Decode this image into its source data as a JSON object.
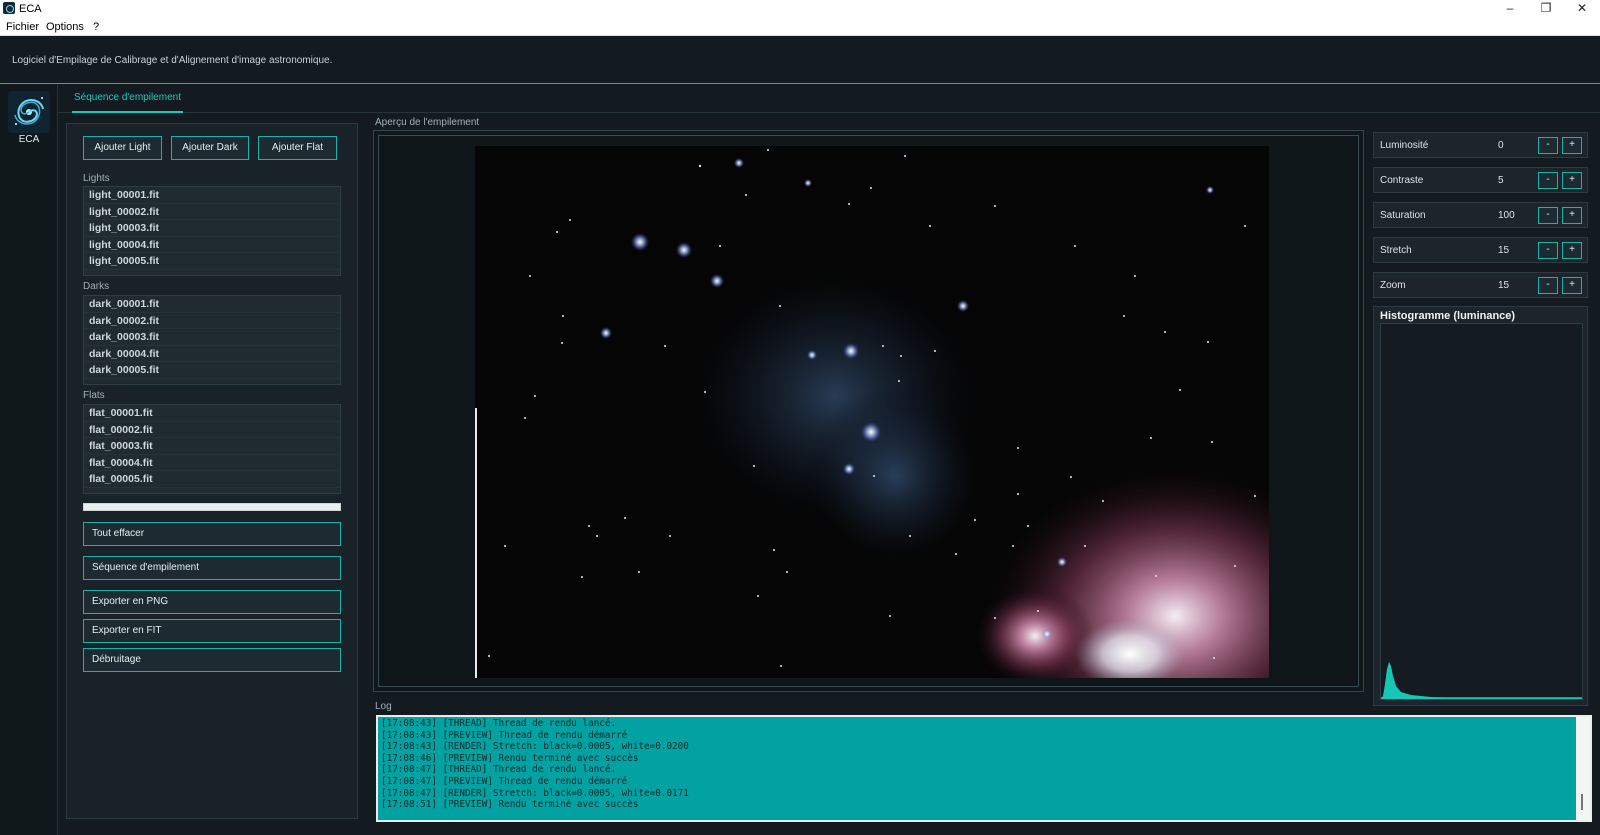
{
  "window": {
    "title": "ECA",
    "minimize": "–",
    "restore": "❐",
    "close": "✕"
  },
  "menu": {
    "items": [
      "Fichier",
      "Options",
      "?"
    ]
  },
  "header": {
    "subtitle": "Logiciel d'Empilage de Calibrage et d'Alignement d'image astronomique."
  },
  "rail": {
    "logo_label": "ECA",
    "logo_icon": "galaxy-icon"
  },
  "tabs": [
    {
      "label": "Séquence d'empilement"
    }
  ],
  "left": {
    "add_light": "Ajouter Light",
    "add_dark": "Ajouter Dark",
    "add_flat": "Ajouter Flat",
    "lights_label": "Lights",
    "lights": [
      "light_00001.fit",
      "light_00002.fit",
      "light_00003.fit",
      "light_00004.fit",
      "light_00005.fit"
    ],
    "darks_label": "Darks",
    "darks": [
      "dark_00001.fit",
      "dark_00002.fit",
      "dark_00003.fit",
      "dark_00004.fit",
      "dark_00005.fit"
    ],
    "flats_label": "Flats",
    "flats": [
      "flat_00001.fit",
      "flat_00002.fit",
      "flat_00003.fit",
      "flat_00004.fit",
      "flat_00005.fit"
    ],
    "progress": 0,
    "clear_all": "Tout effacer",
    "stack_sequence": "Séquence d'empilement",
    "export_png": "Exporter en PNG",
    "export_fit": "Exporter en FIT",
    "denoise": "Débruitage"
  },
  "preview": {
    "label": "Aperçu de l'empilement"
  },
  "controls": [
    {
      "label": "Luminosité",
      "value": "0",
      "minus": "-",
      "plus": "+"
    },
    {
      "label": "Contraste",
      "value": "5",
      "minus": "-",
      "plus": "+"
    },
    {
      "label": "Saturation",
      "value": "100",
      "minus": "-",
      "plus": "+"
    },
    {
      "label": "Stretch",
      "value": "15",
      "minus": "-",
      "plus": "+"
    },
    {
      "label": "Zoom",
      "value": "15",
      "minus": "-",
      "plus": "+"
    }
  ],
  "histogram": {
    "title": "Histogramme (luminance)",
    "color": "#1fc9bc"
  },
  "log": {
    "label": "Log",
    "lines": [
      "[17:08:43] [THREAD] Thread de rendu lancé.",
      "[17:08:43] [PREVIEW] Thread de rendu démarré",
      "[17:08:43] [RENDER] Stretch: black=0.0005, white=0.0200",
      "[17:08:46] [PREVIEW] Rendu terminé avec succès",
      "[17:08:47] [THREAD] Thread de rendu lancé.",
      "[17:08:47] [PREVIEW] Thread de rendu démarré",
      "[17:08:47] [RENDER] Stretch: black=0.0005, white=0.0171",
      "[17:08:51] [PREVIEW] Rendu terminé avec succès"
    ]
  },
  "colors": {
    "accent": "#1fc9bc",
    "log_bg": "#02a2a2",
    "panel": "#192228"
  }
}
